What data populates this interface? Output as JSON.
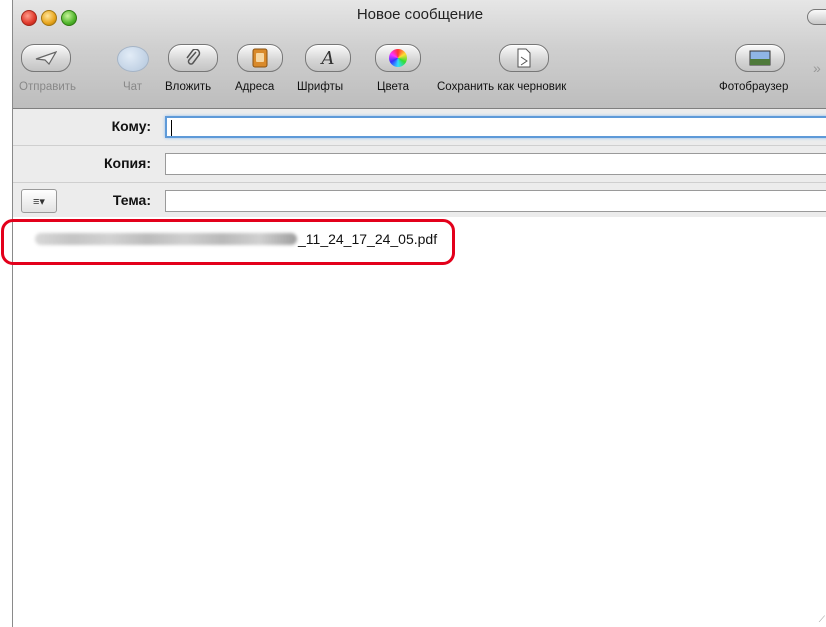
{
  "window": {
    "title": "Новое сообщение"
  },
  "toolbar": {
    "send_label": "Отправить",
    "chat_label": "Чат",
    "attach_label": "Вложить",
    "address_label": "Адреса",
    "fonts_label": "Шрифты",
    "colors_label": "Цвета",
    "save_draft_label": "Сохранить как черновик",
    "photo_browser_label": "Фотобраузер",
    "overflow_glyph": "»",
    "font_button_glyph": "A"
  },
  "fields": {
    "to_label": "Кому:",
    "to_value": "",
    "cc_label": "Копия:",
    "cc_value": "",
    "subject_label": "Тема:",
    "subject_value": "",
    "format_menu_glyph": "≡▾"
  },
  "body": {
    "attachment_filename_visible": "_11_24_17_24_05.pdf"
  },
  "colors": {
    "highlight_border": "#e3001b",
    "focus_ring": "#5e9ad8"
  }
}
